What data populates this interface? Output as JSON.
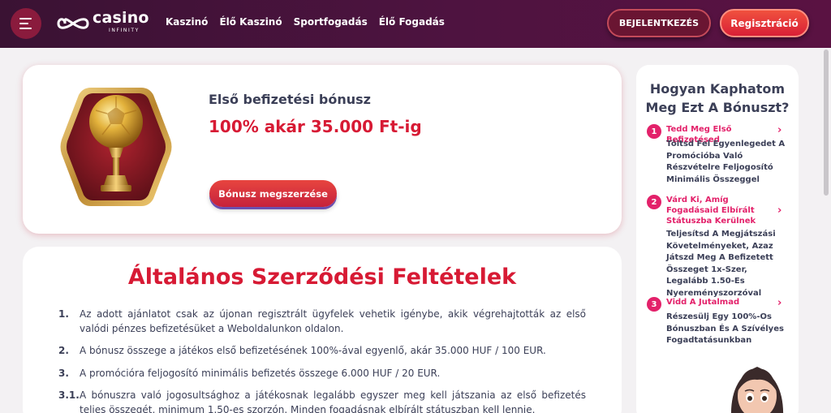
{
  "header": {
    "logo_main": "casino",
    "logo_sub": "INFINITY",
    "nav": [
      "Kaszinó",
      "Élő Kaszinó",
      "Sportfogadás",
      "Élő Fogadás"
    ],
    "login_label": "BEJELENTKEZÉS",
    "register_label": "Regisztráció"
  },
  "promo": {
    "title": "Első befizetési bónusz",
    "amount": "100% akár 35.000 Ft-ig",
    "button": "Bónusz megszerzése"
  },
  "terms": {
    "title": "Általános Szerződési Feltételek",
    "items": [
      {
        "num": "1.",
        "text": "Az adott ajánlatot csak az újonan regisztrált ügyfelek vehetik igénybe, akik végrehajtották az első valódi pénzes befizetésüket a Weboldalunkon oldalon."
      },
      {
        "num": "2.",
        "text": "A bónusz összege a játékos első befizetésének 100%-ával egyenlő, akár 35.000 HUF / 100 EUR."
      },
      {
        "num": "3.",
        "text": "A promócióra feljogosító minimális befizetés összege 6.000 HUF / 20 EUR."
      },
      {
        "num": "3.1.",
        "text": "A bónuszra való jogosultsághoz a játékosnak legalább egyszer meg kell játszania az első befizetés teljes összegét, minimum 1.50-es szorzón. Minden fogadásnak elbírált státuszban kell lennie."
      }
    ]
  },
  "sidebar": {
    "title": "Hogyan Kaphatom Meg Ezt A Bónuszt?",
    "steps": [
      {
        "num": "1",
        "head": "Tedd Meg Első Befizetésed",
        "body": "Töltsd Fel Egyenlegedet A Promócióba Való Részvételre Feljogosító Minimális Összeggel"
      },
      {
        "num": "2",
        "head": "Várd Ki, Amíg Fogadásaid Elbírált Státuszba Kerülnek",
        "body": "Teljesítsd A Megjátszási Követelményeket, Azaz Játszd Meg A Befizetett Összeget 1x-Szer, Legalább 1.50-Es Nyereményszorzóval"
      },
      {
        "num": "3",
        "head": "Vidd A Jutalmad",
        "body": "Részesülj Egy 100%-Os Bónuszban És A Szívélyes Fogadtatásunkban"
      }
    ]
  },
  "icons": {
    "menu": "hamburger-menu-icon",
    "chevron": "chevron-right-icon",
    "trophy": "golden-football-trophy-icon"
  },
  "colors": {
    "accent": "#d71a34",
    "step_pink": "#e3216a",
    "header_bg": "#4e1340"
  }
}
